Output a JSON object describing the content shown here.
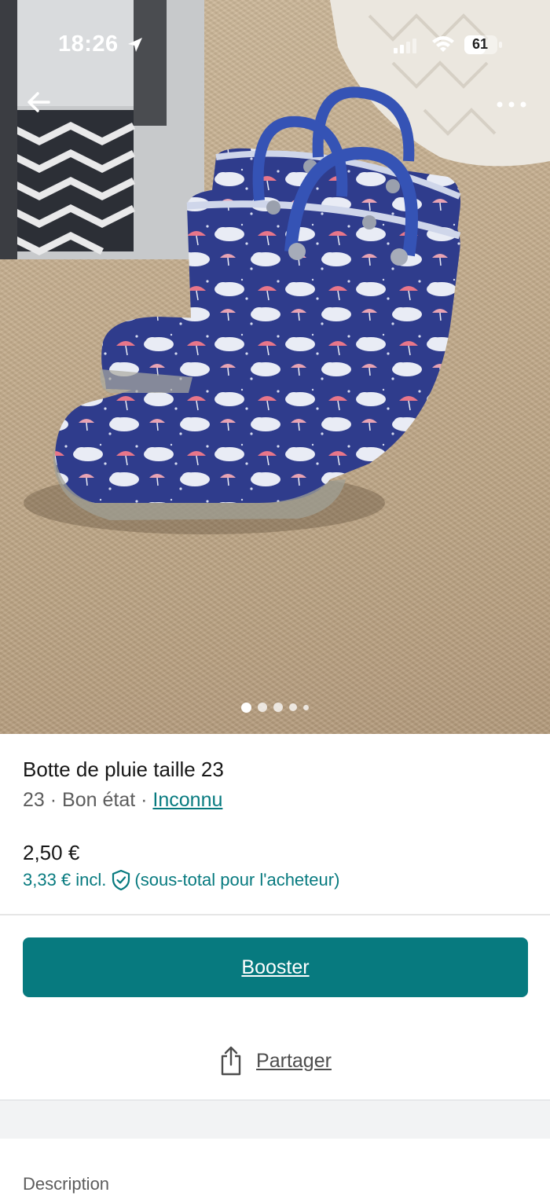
{
  "status_bar": {
    "time": "18:26",
    "battery": "61"
  },
  "photo": {
    "slide_count": 5,
    "active_slide": 1
  },
  "item": {
    "title": "Botte de pluie taille 23",
    "size": "23",
    "separator": "·",
    "condition": "Bon état",
    "brand": "Inconnu",
    "price": "2,50 €",
    "price_incl": "3,33 € incl.",
    "price_incl_note": "(sous-total pour l'acheteur)"
  },
  "actions": {
    "booster_label": "Booster",
    "share_label": "Partager"
  },
  "description": {
    "heading": "Description"
  },
  "colors": {
    "accent": "#077a7f",
    "text": "#171717",
    "muted": "#5c5c5c",
    "band": "#f2f3f4"
  },
  "icons": [
    "location-arrow-icon",
    "signal-icon",
    "wifi-icon",
    "battery-icon",
    "back-arrow-icon",
    "more-dots-icon",
    "shield-check-icon",
    "share-icon"
  ]
}
